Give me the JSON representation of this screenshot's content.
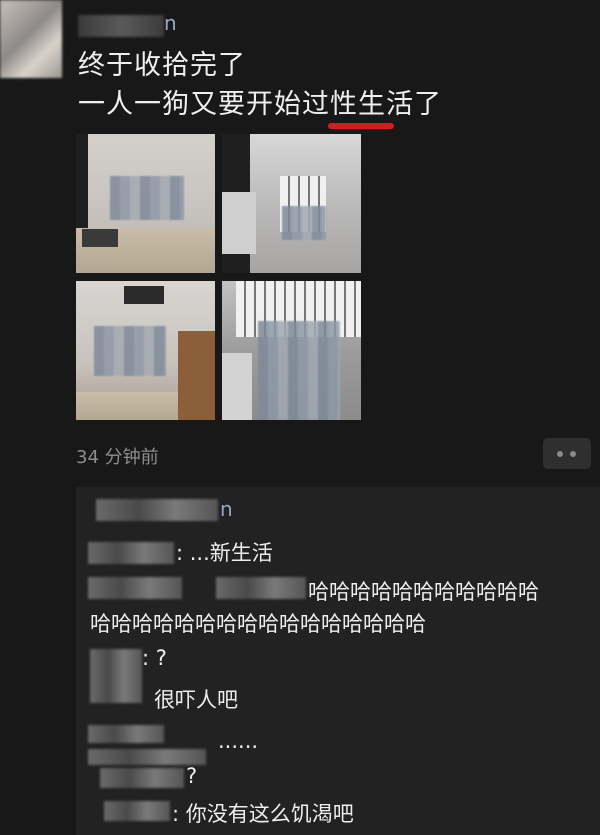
{
  "post": {
    "author_visible": "n",
    "line1": "终于收拾完了",
    "line2": "一人一狗又要开始过性生活了",
    "time": "34 分钟前"
  },
  "comments": {
    "header_name_visible": "n",
    "c1": ": ...新生活",
    "c2_line1": "哈哈哈哈哈哈哈哈哈哈哈",
    "c2_line2": "哈哈哈哈哈哈哈哈哈哈哈哈哈哈哈哈",
    "c3": ": ?",
    "c4": "很吓人吧",
    "c5": "......",
    "c6": "?",
    "c7": ": 你没有这么饥渴吧"
  }
}
